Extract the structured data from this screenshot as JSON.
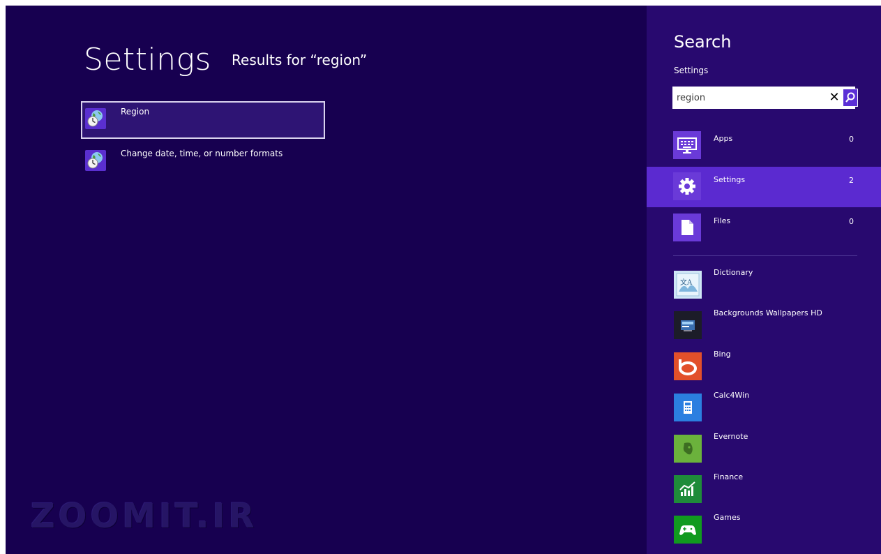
{
  "results": {
    "title": "Settings",
    "query_caption": "Results for “region”",
    "items": [
      {
        "label": "Region",
        "icon": "region-globe-icon"
      },
      {
        "label": "Change date, time, or number formats",
        "icon": "region-globe-icon"
      }
    ]
  },
  "watermark": "ZOOMIT.IR",
  "search_pane": {
    "title": "Search",
    "scope": "Settings",
    "query": "region",
    "clear_symbol": "✕",
    "categories": [
      {
        "label": "Apps",
        "count": "0",
        "icon": "keyboard-icon"
      },
      {
        "label": "Settings",
        "count": "2",
        "icon": "gear-icon",
        "selected": true
      },
      {
        "label": "Files",
        "count": "0",
        "icon": "file-icon"
      }
    ],
    "apps": [
      {
        "label": "Dictionary",
        "icon": "dictionary-icon",
        "color": "#cfe6f6"
      },
      {
        "label": "Backgrounds Wallpapers HD",
        "icon": "wallpapers-icon",
        "color": "#1c1c28"
      },
      {
        "label": "Bing",
        "icon": "bing-icon",
        "color": "#e2502a"
      },
      {
        "label": "Calc4Win",
        "icon": "calculator-icon",
        "color": "#2b7fe0"
      },
      {
        "label": "Evernote",
        "icon": "evernote-icon",
        "color": "#6bb23c"
      },
      {
        "label": "Finance",
        "icon": "finance-icon",
        "color": "#1f8b3a"
      },
      {
        "label": "Games",
        "icon": "games-controller-icon",
        "color": "#119a1f"
      }
    ]
  },
  "colors": {
    "background": "#170050",
    "pane": "#28096f",
    "accent": "#5b2ad0"
  }
}
